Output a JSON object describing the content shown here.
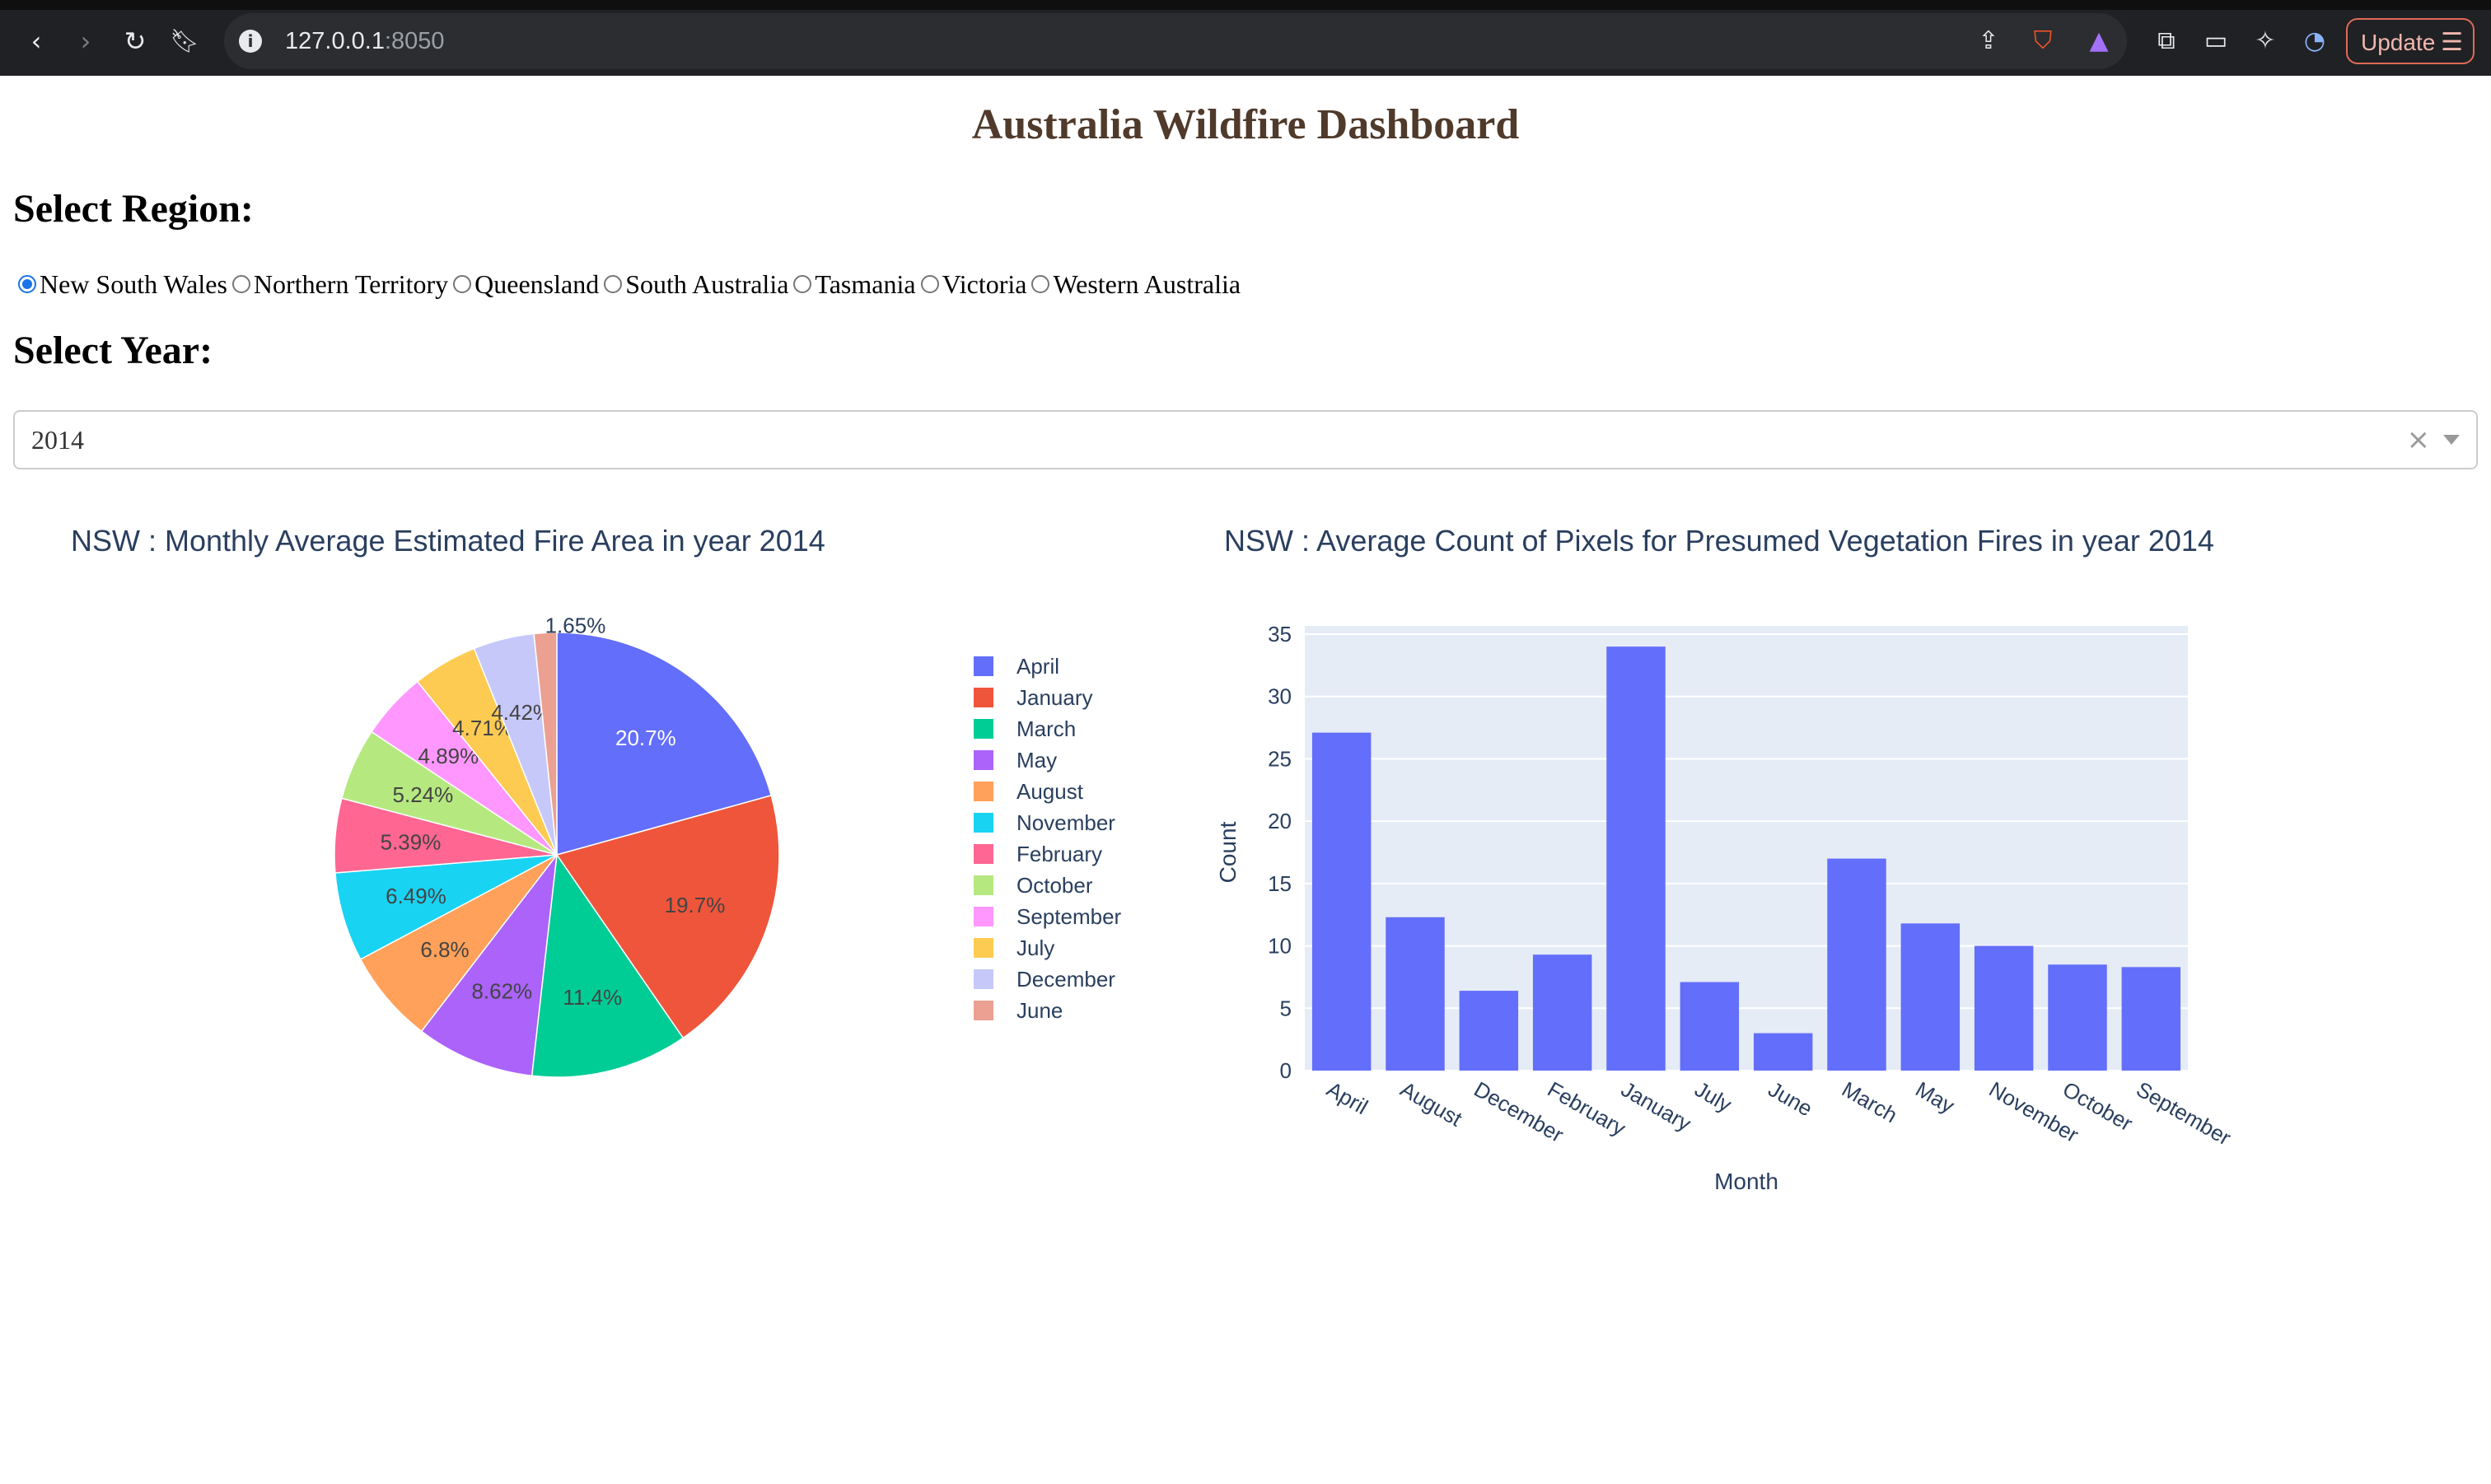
{
  "browser": {
    "url_host": "127.0.0.1",
    "url_port": ":8050",
    "update_label": "Update"
  },
  "page": {
    "title": "Australia Wildfire Dashboard",
    "region_heading": "Select Region:",
    "year_heading": "Select Year:",
    "regions": [
      "New South Wales",
      "Northern Territory",
      "Queensland",
      "South Australia",
      "Tasmania",
      "Victoria",
      "Western Australia"
    ],
    "selected_region": "New South Wales",
    "year_value": "2014"
  },
  "colors": {
    "title": "#503a2b",
    "bar": "#636efa",
    "plot_bg": "#e5ecf6",
    "text": "#2a3f5f"
  },
  "chart_data": [
    {
      "type": "pie",
      "title": "NSW : Monthly Average Estimated Fire Area in year 2014",
      "labels": [
        "April",
        "January",
        "March",
        "May",
        "August",
        "November",
        "February",
        "October",
        "September",
        "July",
        "December",
        "June"
      ],
      "values": [
        20.7,
        19.7,
        11.4,
        8.62,
        6.8,
        6.49,
        5.39,
        5.24,
        4.89,
        4.71,
        4.42,
        1.65
      ],
      "value_labels": [
        "20.7%",
        "19.7%",
        "11.4%",
        "8.62%",
        "6.8%",
        "6.49%",
        "5.39%",
        "5.24%",
        "4.89%",
        "4.71%",
        "4.42%",
        "1.65%"
      ],
      "colors": [
        "#636efa",
        "#ef553b",
        "#00cc96",
        "#ab63fa",
        "#ffa15a",
        "#19d3f3",
        "#ff6692",
        "#b6e880",
        "#ff97ff",
        "#fecb52",
        "#c6c8fa",
        "#eba092"
      ],
      "legend": "right"
    },
    {
      "type": "bar",
      "title": "NSW : Average Count of Pixels for Presumed Vegetation Fires in year 2014",
      "categories": [
        "April",
        "August",
        "December",
        "February",
        "January",
        "July",
        "June",
        "March",
        "May",
        "November",
        "October",
        "September"
      ],
      "values": [
        27.1,
        12.3,
        6.4,
        9.3,
        34,
        7.1,
        3,
        17,
        11.8,
        10,
        8.5,
        8.3
      ],
      "xlabel": "Month",
      "ylabel": "Count",
      "ylim": [
        0,
        35
      ],
      "yticks": [
        0,
        5,
        10,
        15,
        20,
        25,
        30,
        35
      ],
      "grid": true,
      "color": "#636efa"
    }
  ]
}
